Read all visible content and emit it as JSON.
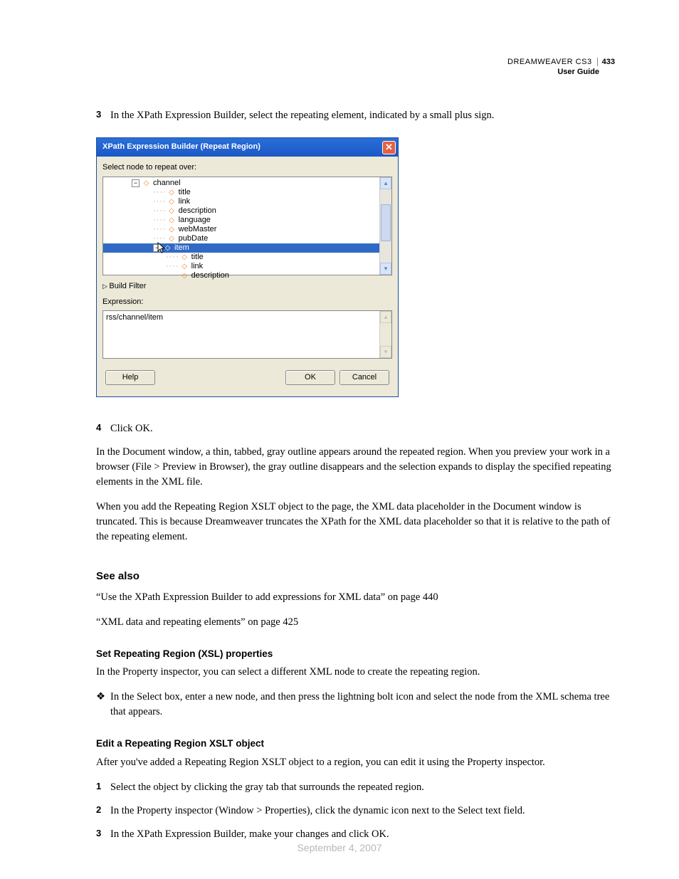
{
  "header": {
    "product": "DREAMWEAVER CS3",
    "page_number": "433",
    "subtitle": "User Guide"
  },
  "step3": {
    "num": "3",
    "text": "In the XPath Expression Builder, select the repeating element, indicated by a small plus sign."
  },
  "dialog": {
    "title": "XPath Expression Builder (Repeat Region)",
    "prompt": "Select node to repeat over:",
    "tree": {
      "channel": "channel",
      "title": "title",
      "link": "link",
      "description": "description",
      "language": "language",
      "webMaster": "webMaster",
      "pubDate": "pubDate",
      "item": "item",
      "item_title": "title",
      "item_link": "link",
      "item_description": "description"
    },
    "build_filter": "Build Filter",
    "expression_label": "Expression:",
    "expression_value": "rss/channel/item",
    "buttons": {
      "help": "Help",
      "ok": "OK",
      "cancel": "Cancel"
    }
  },
  "step4": {
    "num": "4",
    "text": "Click OK."
  },
  "para1": "In the Document window, a thin, tabbed, gray outline appears around the repeated region. When you preview your work in a browser (File > Preview in Browser), the gray outline disappears and the selection expands to display the specified repeating elements in the XML file.",
  "para2": "When you add the Repeating Region XSLT object to the page, the XML data placeholder in the Document window is truncated. This is because Dreamweaver truncates the XPath for the XML data placeholder so that it is relative to the path of the repeating element.",
  "see_also": {
    "heading": "See also",
    "link1": "“Use the XPath Expression Builder to add expressions for XML data” on page 440",
    "link2": "“XML data and repeating elements” on page 425"
  },
  "set_props": {
    "heading": "Set Repeating Region (XSL) properties",
    "text": "In the Property inspector, you can select a different XML node to create the repeating region.",
    "bullet": "In the Select box, enter a new node, and then press the lightning bolt icon and select the node from the XML schema tree that appears."
  },
  "edit_region": {
    "heading": "Edit a Repeating Region XSLT object",
    "text": "After you've added a Repeating Region XSLT object to a region, you can edit it using the Property inspector.",
    "s1n": "1",
    "s1": "Select the object by clicking the gray tab that surrounds the repeated region.",
    "s2n": "2",
    "s2": "In the Property inspector (Window > Properties), click the dynamic icon next to the Select text field.",
    "s3n": "3",
    "s3": "In the XPath Expression Builder, make your changes and click OK."
  },
  "footer_date": "September 4, 2007"
}
